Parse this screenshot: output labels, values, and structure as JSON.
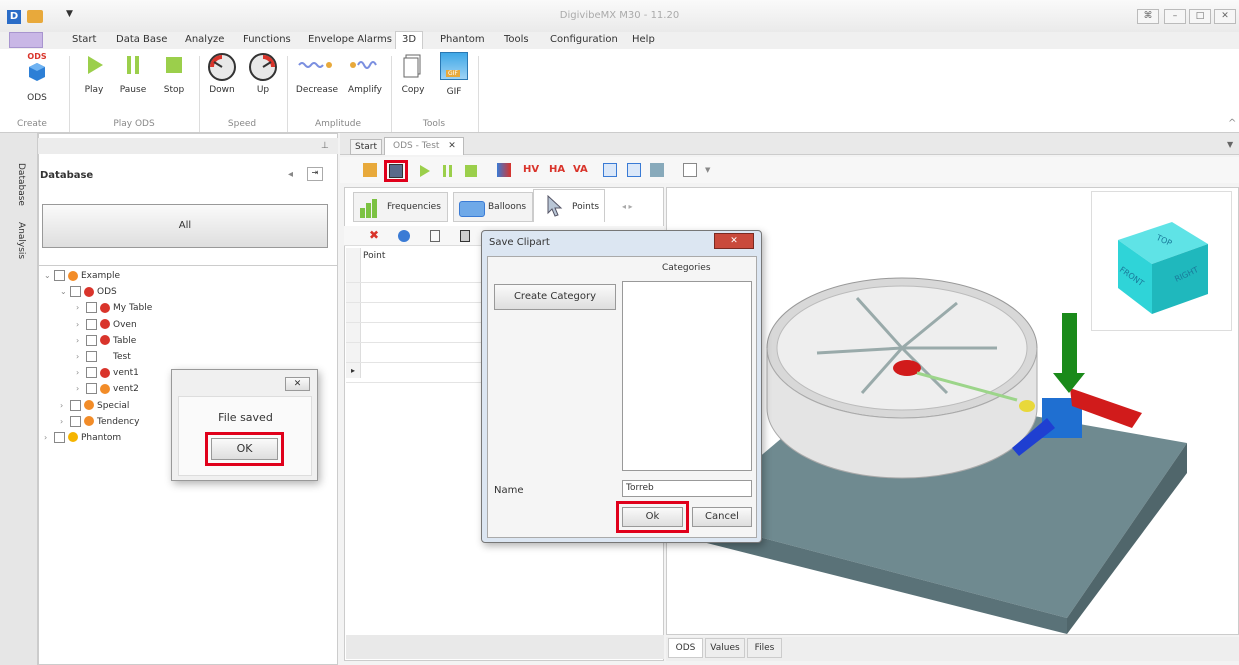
{
  "window": {
    "title": "DigivibeMX M30 - 11.20",
    "app_icon_letter": "D",
    "controls": [
      "⌘",
      "–",
      "□",
      "✕"
    ]
  },
  "menu": {
    "items": [
      "Start",
      "Data Base",
      "Analyze",
      "Functions",
      "Envelope Alarms",
      "3D",
      "Phantom",
      "Tools",
      "Configuration",
      "Help"
    ],
    "active": "3D"
  },
  "ribbon": {
    "ods_badge": "ODS",
    "buttons": {
      "ods": "ODS",
      "play": "Play",
      "pause": "Pause",
      "stop": "Stop",
      "down": "Down",
      "up": "Up",
      "decrease": "Decrease",
      "amplify": "Amplify",
      "copy": "Copy",
      "gif": "GIF"
    },
    "groups": {
      "create": "Create",
      "play_ods": "Play ODS",
      "speed": "Speed",
      "amplitude": "Amplitude",
      "tools": "Tools"
    },
    "gif_badge": "GIF"
  },
  "side_tabs": {
    "database": "Database",
    "analysis": "Analysis"
  },
  "database": {
    "title": "Database",
    "all_label": "All",
    "tree": [
      {
        "label": "Example",
        "color": "#f28c28",
        "level": 0,
        "expanded": true
      },
      {
        "label": "ODS",
        "color": "#d9342b",
        "level": 1,
        "expanded": true
      },
      {
        "label": "My Table",
        "color": "#d9342b",
        "level": 2
      },
      {
        "label": "Oven",
        "color": "#d9342b",
        "level": 2
      },
      {
        "label": "Table",
        "color": "#d9342b",
        "level": 2
      },
      {
        "label": "Test",
        "color": "",
        "level": 2
      },
      {
        "label": "vent1",
        "color": "#d9342b",
        "level": 2
      },
      {
        "label": "vent2",
        "color": "#f28c28",
        "level": 2
      },
      {
        "label": "Special",
        "color": "#f28c28",
        "level": 1
      },
      {
        "label": "Tendency",
        "color": "#f28c28",
        "level": 1
      },
      {
        "label": "Phantom",
        "color": "#f5b400",
        "level": 0
      }
    ]
  },
  "file_saved_dialog": {
    "message": "File saved",
    "ok": "OK",
    "close": "✕"
  },
  "doc_tabs": {
    "start": "Start",
    "ods_test": "ODS - Test",
    "close": "✕"
  },
  "toolbar": {
    "hv": "HV",
    "ha": "HA",
    "va": "VA"
  },
  "subtabs": {
    "frequencies": "Frequencies",
    "balloons": "Balloons",
    "points": "Points"
  },
  "points_table": {
    "header": "Point"
  },
  "save_clipart": {
    "title": "Save Clipart",
    "categories_label": "Categories",
    "create_category": "Create Category",
    "name_label": "Name",
    "name_value": "Torreb",
    "ok": "Ok",
    "cancel": "Cancel",
    "close": "✕"
  },
  "cube": {
    "top": "TOP",
    "front": "FRONT",
    "right": "RIGHT"
  },
  "view_tabs": [
    "ODS",
    "Values",
    "Files"
  ],
  "colors": {
    "highlight": "#e0001b",
    "slab": "#6f8a90",
    "cube": "#2fd4d8",
    "arrow_x": "#d11b1b",
    "arrow_y": "#1a8a1a",
    "arrow_z": "#1f3fd1"
  }
}
